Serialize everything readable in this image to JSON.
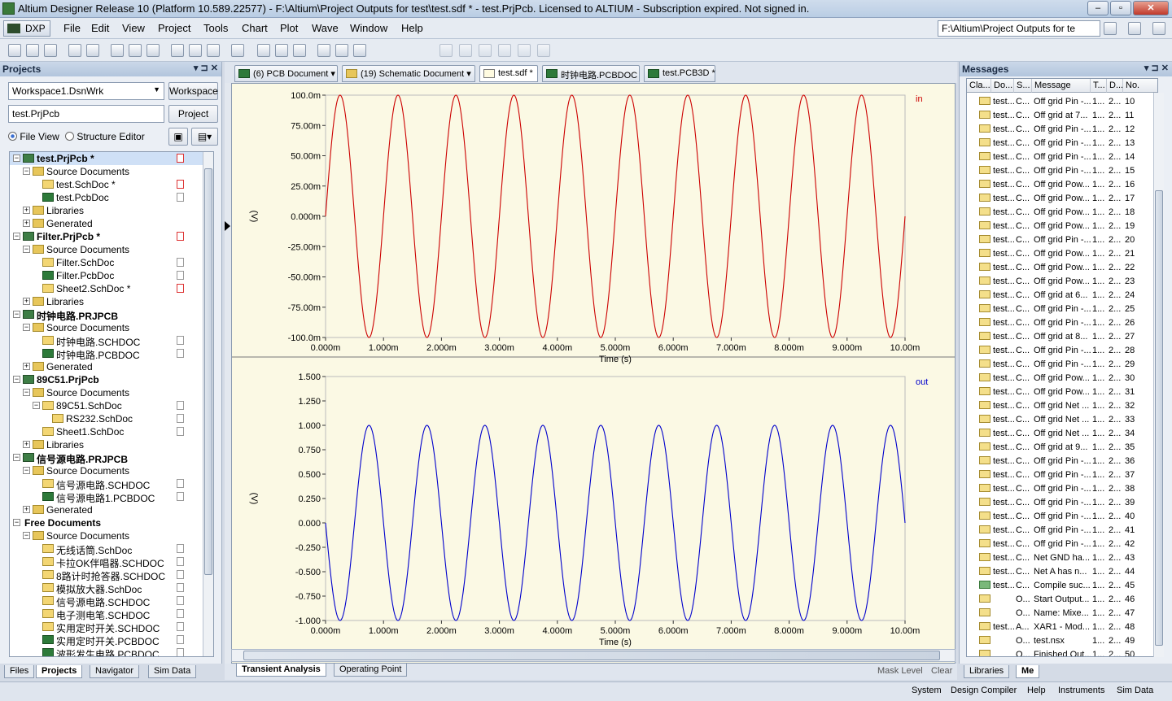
{
  "window": {
    "title": "Altium Designer Release 10 (Platform 10.589.22577) - F:\\Altium\\Project Outputs for test\\test.sdf * - test.PrjPcb. Licensed to ALTIUM - Subscription expired. Not signed in."
  },
  "menubar": {
    "dxp": "DXP",
    "items": [
      "File",
      "Edit",
      "View",
      "Project",
      "Tools",
      "Chart",
      "Plot",
      "Wave",
      "Window",
      "Help"
    ],
    "path": "F:\\Altium\\Project Outputs for te"
  },
  "projects": {
    "title": "Projects",
    "workspace_value": "Workspace1.DsnWrk",
    "workspace_button": "Workspace",
    "project_value": "test.PrjPcb",
    "project_button": "Project",
    "file_view": "File View",
    "structure_editor": "Structure Editor",
    "tree": [
      {
        "label": "test.PrjPcb *",
        "level": 0,
        "type": "prj",
        "bold": true,
        "selected": true,
        "mark": "red"
      },
      {
        "label": "Source Documents",
        "level": 1,
        "type": "folder"
      },
      {
        "label": "test.SchDoc *",
        "level": 2,
        "type": "sch",
        "mark": "red"
      },
      {
        "label": "test.PcbDoc",
        "level": 2,
        "type": "pcb",
        "mark": "doc"
      },
      {
        "label": "Libraries",
        "level": 1,
        "type": "folder",
        "collapsed": true
      },
      {
        "label": "Generated",
        "level": 1,
        "type": "folder",
        "collapsed": true
      },
      {
        "label": "Filter.PrjPcb *",
        "level": 0,
        "type": "prj",
        "bold": true,
        "mark": "red"
      },
      {
        "label": "Source Documents",
        "level": 1,
        "type": "folder"
      },
      {
        "label": "Filter.SchDoc",
        "level": 2,
        "type": "sch",
        "mark": "doc"
      },
      {
        "label": "Filter.PcbDoc",
        "level": 2,
        "type": "pcb",
        "mark": "doc"
      },
      {
        "label": "Sheet2.SchDoc *",
        "level": 2,
        "type": "sch",
        "mark": "red"
      },
      {
        "label": "Libraries",
        "level": 1,
        "type": "folder",
        "collapsed": true
      },
      {
        "label": "时钟电路.PRJPCB",
        "level": 0,
        "type": "prj",
        "bold": true
      },
      {
        "label": "Source Documents",
        "level": 1,
        "type": "folder"
      },
      {
        "label": "时钟电路.SCHDOC",
        "level": 2,
        "type": "sch",
        "mark": "doc"
      },
      {
        "label": "时钟电路.PCBDOC",
        "level": 2,
        "type": "pcb",
        "mark": "doc"
      },
      {
        "label": "Generated",
        "level": 1,
        "type": "folder",
        "collapsed": true
      },
      {
        "label": "89C51.PrjPcb",
        "level": 0,
        "type": "prj",
        "bold": true
      },
      {
        "label": "Source Documents",
        "level": 1,
        "type": "folder"
      },
      {
        "label": "89C51.SchDoc",
        "level": 2,
        "type": "sch",
        "mark": "doc",
        "expander": true
      },
      {
        "label": "RS232.SchDoc",
        "level": 3,
        "type": "sch",
        "mark": "doc"
      },
      {
        "label": "Sheet1.SchDoc",
        "level": 2,
        "type": "sch",
        "mark": "doc"
      },
      {
        "label": "Libraries",
        "level": 1,
        "type": "folder",
        "collapsed": true
      },
      {
        "label": "信号源电路.PRJPCB",
        "level": 0,
        "type": "prj",
        "bold": true
      },
      {
        "label": "Source Documents",
        "level": 1,
        "type": "folder"
      },
      {
        "label": "信号源电路.SCHDOC",
        "level": 2,
        "type": "sch",
        "mark": "doc"
      },
      {
        "label": "信号源电路1.PCBDOC",
        "level": 2,
        "type": "pcb",
        "mark": "doc"
      },
      {
        "label": "Generated",
        "level": 1,
        "type": "folder",
        "collapsed": true
      },
      {
        "label": "Free Documents",
        "level": 0,
        "type": "none",
        "bold": true
      },
      {
        "label": "Source Documents",
        "level": 1,
        "type": "folder"
      },
      {
        "label": "无线话筒.SchDoc",
        "level": 2,
        "type": "sch",
        "mark": "doc"
      },
      {
        "label": "卡拉OK伴唱器.SCHDOC",
        "level": 2,
        "type": "sch",
        "mark": "doc"
      },
      {
        "label": "8路计时抢答器.SCHDOC",
        "level": 2,
        "type": "sch",
        "mark": "doc"
      },
      {
        "label": "模拟放大器.SchDoc",
        "level": 2,
        "type": "sch",
        "mark": "doc"
      },
      {
        "label": "信号源电路.SCHDOC",
        "level": 2,
        "type": "sch",
        "mark": "doc"
      },
      {
        "label": "电子测电笔.SCHDOC",
        "level": 2,
        "type": "sch",
        "mark": "doc"
      },
      {
        "label": "实用定时开关.SCHDOC",
        "level": 2,
        "type": "sch",
        "mark": "doc"
      },
      {
        "label": "实用定时开关.PCBDOC",
        "level": 2,
        "type": "pcb",
        "mark": "doc"
      },
      {
        "label": "波形发生电路.PCBDOC",
        "level": 2,
        "type": "pcb",
        "mark": "doc"
      }
    ],
    "bottom_tabs": [
      "Files",
      "Projects",
      "Navigator",
      "Sim Data"
    ]
  },
  "doc_tabs": [
    {
      "label": "(6) PCB Document",
      "dropdown": true
    },
    {
      "label": "(19) Schematic Document",
      "dropdown": true
    },
    {
      "label": "test.sdf *"
    },
    {
      "label": "时钟电路.PCBDOC"
    },
    {
      "label": "test.PCB3D *"
    }
  ],
  "chart_data": [
    {
      "type": "line",
      "series": [
        {
          "name": "in",
          "color": "#cc0000",
          "frequency_khz": 1.0,
          "amplitude": 0.1,
          "phase": "sin"
        }
      ],
      "x_range": [
        0,
        10.0
      ],
      "x_ticks": [
        "0.000m",
        "1.000m",
        "2.000m",
        "3.000m",
        "4.000m",
        "5.000m",
        "6.000m",
        "7.000m",
        "8.000m",
        "9.000m",
        "10.00m"
      ],
      "y_range": [
        -0.1,
        0.1
      ],
      "y_ticks": [
        "100.0m",
        "75.00m",
        "50.00m",
        "25.00m",
        "0.000m",
        "-25.00m",
        "-50.00m",
        "-75.00m",
        "-100.0m"
      ],
      "xlabel": "Time (s)",
      "ylabel": "(V)"
    },
    {
      "type": "line",
      "series": [
        {
          "name": "out",
          "color": "#0000cc",
          "frequency_khz": 1.0,
          "amplitude": 1.0,
          "phase": "-sin"
        }
      ],
      "x_range": [
        0,
        10.0
      ],
      "x_ticks": [
        "0.000m",
        "1.000m",
        "2.000m",
        "3.000m",
        "4.000m",
        "5.000m",
        "6.000m",
        "7.000m",
        "8.000m",
        "9.000m",
        "10.00m"
      ],
      "y_range": [
        -1.0,
        1.5
      ],
      "y_ticks": [
        "1.500",
        "1.250",
        "1.000",
        "0.750",
        "0.500",
        "0.250",
        "0.000",
        "-0.250",
        "-0.500",
        "-0.750",
        "-1.000"
      ],
      "xlabel": "Time (s)",
      "ylabel": "(V)"
    }
  ],
  "chart_tabs": [
    "Transient Analysis",
    "Operating Point"
  ],
  "chart_footer": {
    "mask_level": "Mask Level",
    "clear": "Clear"
  },
  "messages": {
    "title": "Messages",
    "headers": [
      "Cla...",
      "Do...",
      "S...",
      "Message",
      "T...",
      "D...",
      "No."
    ],
    "rows": [
      [
        "test...",
        "C...",
        "Off grid Pin -...",
        "1...",
        "2...",
        "10"
      ],
      [
        "test...",
        "C...",
        "Off grid  at 7...",
        "1...",
        "2...",
        "11"
      ],
      [
        "test...",
        "C...",
        "Off grid Pin -...",
        "1...",
        "2...",
        "12"
      ],
      [
        "test...",
        "C...",
        "Off grid Pin -...",
        "1...",
        "2...",
        "13"
      ],
      [
        "test...",
        "C...",
        "Off grid Pin -...",
        "1...",
        "2...",
        "14"
      ],
      [
        "test...",
        "C...",
        "Off grid Pin -...",
        "1...",
        "2...",
        "15"
      ],
      [
        "test...",
        "C...",
        "Off grid Pow...",
        "1...",
        "2...",
        "16"
      ],
      [
        "test...",
        "C...",
        "Off grid Pow...",
        "1...",
        "2...",
        "17"
      ],
      [
        "test...",
        "C...",
        "Off grid Pow...",
        "1...",
        "2...",
        "18"
      ],
      [
        "test...",
        "C...",
        "Off grid Pow...",
        "1...",
        "2...",
        "19"
      ],
      [
        "test...",
        "C...",
        "Off grid Pin -...",
        "1...",
        "2...",
        "20"
      ],
      [
        "test...",
        "C...",
        "Off grid Pow...",
        "1...",
        "2...",
        "21"
      ],
      [
        "test...",
        "C...",
        "Off grid Pow...",
        "1...",
        "2...",
        "22"
      ],
      [
        "test...",
        "C...",
        "Off grid Pow...",
        "1...",
        "2...",
        "23"
      ],
      [
        "test...",
        "C...",
        "Off grid  at 6...",
        "1...",
        "2...",
        "24"
      ],
      [
        "test...",
        "C...",
        "Off grid Pin -...",
        "1...",
        "2...",
        "25"
      ],
      [
        "test...",
        "C...",
        "Off grid Pin -...",
        "1...",
        "2...",
        "26"
      ],
      [
        "test...",
        "C...",
        "Off grid  at 8...",
        "1...",
        "2...",
        "27"
      ],
      [
        "test...",
        "C...",
        "Off grid Pin -...",
        "1...",
        "2...",
        "28"
      ],
      [
        "test...",
        "C...",
        "Off grid Pin -...",
        "1...",
        "2...",
        "29"
      ],
      [
        "test...",
        "C...",
        "Off grid Pow...",
        "1...",
        "2...",
        "30"
      ],
      [
        "test...",
        "C...",
        "Off grid Pow...",
        "1...",
        "2...",
        "31"
      ],
      [
        "test...",
        "C...",
        "Off grid Net ...",
        "1...",
        "2...",
        "32"
      ],
      [
        "test...",
        "C...",
        "Off grid Net ...",
        "1...",
        "2...",
        "33"
      ],
      [
        "test...",
        "C...",
        "Off grid Net ...",
        "1...",
        "2...",
        "34"
      ],
      [
        "test...",
        "C...",
        "Off grid  at 9...",
        "1...",
        "2...",
        "35"
      ],
      [
        "test...",
        "C...",
        "Off grid Pin -...",
        "1...",
        "2...",
        "36"
      ],
      [
        "test...",
        "C...",
        "Off grid Pin -...",
        "1...",
        "2...",
        "37"
      ],
      [
        "test...",
        "C...",
        "Off grid Pin -...",
        "1...",
        "2...",
        "38"
      ],
      [
        "test...",
        "C...",
        "Off grid Pin -...",
        "1...",
        "2...",
        "39"
      ],
      [
        "test...",
        "C...",
        "Off grid Pin -...",
        "1...",
        "2...",
        "40"
      ],
      [
        "test...",
        "C...",
        "Off grid Pin -...",
        "1...",
        "2...",
        "41"
      ],
      [
        "test...",
        "C...",
        "Off grid Pin -...",
        "1...",
        "2...",
        "42"
      ],
      [
        "test...",
        "C...",
        "Net GND ha...",
        "1...",
        "2...",
        "43"
      ],
      [
        "test...",
        "C...",
        "Net A has n...",
        "1...",
        "2...",
        "44"
      ],
      [
        "test...",
        "C...",
        "Compile suc...",
        "1...",
        "2...",
        "45"
      ],
      [
        "",
        "O...",
        "Start Output...",
        "1...",
        "2...",
        "46"
      ],
      [
        "",
        "O...",
        "Name: Mixe...",
        "1...",
        "2...",
        "47"
      ],
      [
        "test...",
        "A...",
        "XAR1 - Mod...",
        "1...",
        "2...",
        "48"
      ],
      [
        "",
        "O...",
        "test.nsx",
        "1...",
        "2...",
        "49"
      ],
      [
        "",
        "O...",
        "Finished Out...",
        "1...",
        "2...",
        "50"
      ]
    ],
    "bottom_tabs": [
      "Libraries",
      "Me"
    ]
  },
  "statusbar": [
    "System",
    "Design Compiler",
    "Help",
    "Instruments",
    "Sim Data"
  ]
}
